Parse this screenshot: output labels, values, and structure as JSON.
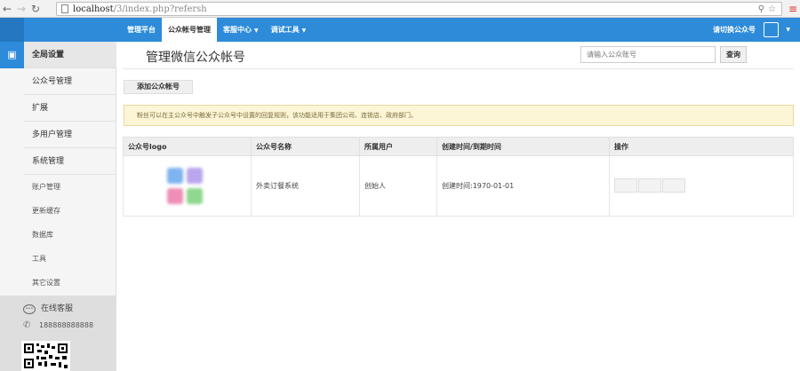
{
  "browser": {
    "url_host": "localhost",
    "url_path": "/3/index.php?refersh"
  },
  "navbar": {
    "items": [
      {
        "label": "管理平台",
        "active": false
      },
      {
        "label": "公众帐号管理",
        "active": true
      },
      {
        "label": "客服中心",
        "dropdown": true
      },
      {
        "label": "调试工具",
        "dropdown": true
      }
    ],
    "switch_account": "请切换公众号"
  },
  "sidebar": {
    "items": [
      "全局设置",
      "公众号管理",
      "扩展",
      "多用户管理",
      "系统管理"
    ],
    "sub_items": [
      "账户管理",
      "更新缓存",
      "数据库",
      "工具",
      "其它设置"
    ],
    "support_label": "在线客服",
    "phone": "188888888888"
  },
  "main": {
    "title": "管理微信公众帐号",
    "search_placeholder": "请输入公众账号",
    "search_button": "查询",
    "add_button": "添加公众帐号",
    "alert": "粉丝可以在主公众号中触发子公众号中设置的回复规则，该功能适用于集团公司、连锁店、政府部门。",
    "table": {
      "headers": [
        "公众号logo",
        "公众号名称",
        "所属用户",
        "创建时间/到期时间",
        "操作"
      ],
      "rows": [
        {
          "name": "外卖订餐系统",
          "owner": "创始人",
          "created": "创建时间:1970-01-01"
        }
      ]
    }
  },
  "colors": {
    "navbar": "#2d8bda",
    "alert_bg": "#fcf5d6"
  }
}
